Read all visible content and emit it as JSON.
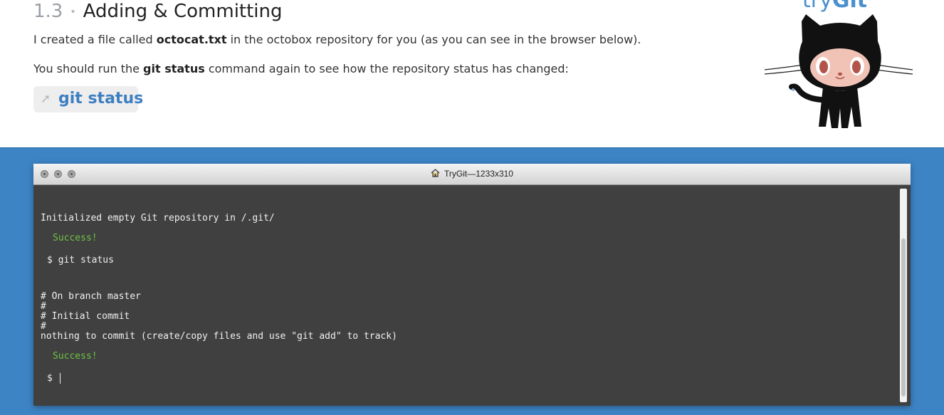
{
  "lesson": {
    "number": "1.3",
    "separator": "•",
    "title": "Adding & Committing",
    "p1_a": "I created a file called ",
    "p1_b": "octocat.txt",
    "p1_c": " in the octobox repository for you (as you can see in the browser below).",
    "p2_a": "You should run the ",
    "p2_b": "git status",
    "p2_c": " command again to see how the repository status has changed:",
    "command_label": "git status",
    "command_icon": "arrow-icon"
  },
  "logo": {
    "try": "try",
    "git": "Git"
  },
  "terminal": {
    "title": "TryGit—1233x310",
    "title_icon": "home-icon",
    "lines": [
      "Initialized empty Git repository in /.git/",
      "Success!",
      "$ git status",
      "# On branch master",
      "#",
      "# Initial commit",
      "#",
      "nothing to commit (create/copy files and use \"git add\" to track)",
      "Success!",
      "$"
    ]
  },
  "colors": {
    "accent": "#3e7fc1",
    "stage": "#3d84c5",
    "terminal_bg": "#404040",
    "success": "#6ec242"
  }
}
